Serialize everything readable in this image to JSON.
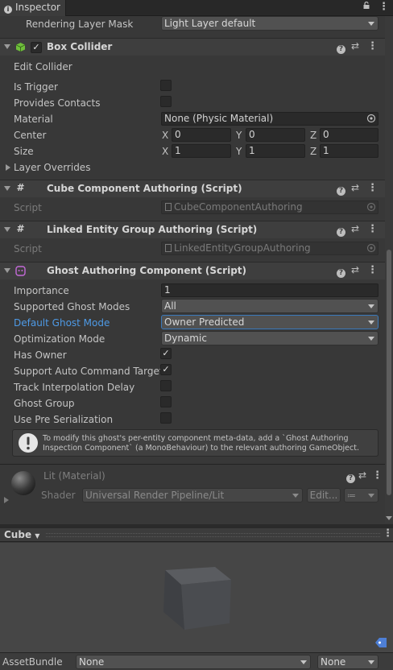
{
  "tab": {
    "title": "Inspector",
    "icon": "info-icon"
  },
  "rendering": {
    "label": "Rendering Layer Mask",
    "value": "Light Layer default"
  },
  "box_collider": {
    "title": "Box Collider",
    "edit_collider": "Edit Collider",
    "is_trigger": "Is Trigger",
    "provides_contacts": "Provides Contacts",
    "material_label": "Material",
    "material_value": "None (Physic Material)",
    "center_label": "Center",
    "center": {
      "x": "0",
      "y": "0",
      "z": "0"
    },
    "size_label": "Size",
    "size": {
      "x": "1",
      "y": "1",
      "z": "1"
    },
    "layer_overrides": "Layer Overrides",
    "axis": {
      "x": "X",
      "y": "Y",
      "z": "Z"
    }
  },
  "cube_component": {
    "title": "Cube Component Authoring (Script)",
    "script_label": "Script",
    "script_value": "CubeComponentAuthoring"
  },
  "linked_entity": {
    "title": "Linked Entity Group Authoring (Script)",
    "script_label": "Script",
    "script_value": "LinkedEntityGroupAuthoring"
  },
  "ghost": {
    "title": "Ghost Authoring Component (Script)",
    "importance_label": "Importance",
    "importance_value": "1",
    "supported_modes_label": "Supported Ghost Modes",
    "supported_modes_value": "All",
    "default_mode_label": "Default Ghost Mode",
    "default_mode_value": "Owner Predicted",
    "optimization_label": "Optimization Mode",
    "optimization_value": "Dynamic",
    "has_owner": "Has Owner",
    "auto_command": "Support Auto Command Target",
    "track_interp": "Track Interpolation Delay",
    "ghost_group": "Ghost Group",
    "pre_serialization": "Use Pre Serialization",
    "info": "To modify this ghost's per-entity component meta-data, add a `Ghost Authoring Inspection Component` (a MonoBehaviour) to the relevant authoring GameObject."
  },
  "material": {
    "title": "Lit (Material)",
    "shader_label": "Shader",
    "shader_value": "Universal Render Pipeline/Lit",
    "edit_button": "Edit..."
  },
  "preview": {
    "title": "Cube"
  },
  "asset_bundle": {
    "label": "AssetBundle",
    "value1": "None",
    "value2": "None"
  },
  "colors": {
    "accent": "#3a79bb",
    "link": "#4e9ae6",
    "bg": "#383838"
  }
}
